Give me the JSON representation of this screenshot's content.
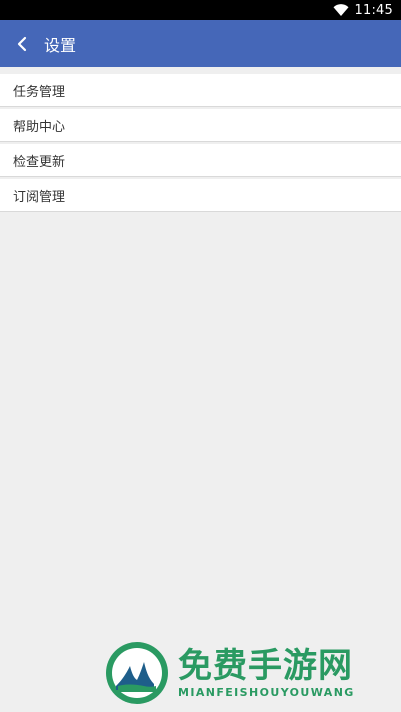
{
  "status_bar": {
    "time": "11:45",
    "wifi_icon": "wifi-icon"
  },
  "toolbar": {
    "back_icon": "chevron-left-icon",
    "title": "设置",
    "background": "#4567b8"
  },
  "menu": {
    "items": [
      {
        "label": "任务管理"
      },
      {
        "label": "帮助中心"
      },
      {
        "label": "检查更新"
      },
      {
        "label": "订阅管理"
      }
    ]
  },
  "watermark": {
    "title": "免费手游网",
    "subtitle": "MIANFEISHOUYOUWANG",
    "logo_icon": "m-logo-icon",
    "color": "#2a9a62"
  }
}
